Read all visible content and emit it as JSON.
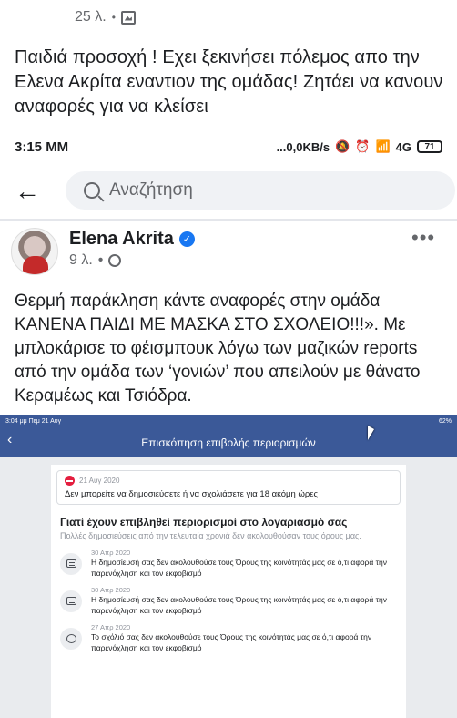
{
  "top_post": {
    "time": "25 λ.",
    "text": "Παιδιά προσοχή ! Εχει ξεκινήσει πόλεμος απο την Ελενα Ακρίτα εναντιον της ομάδας! Ζητάει να κανουν αναφορές για να κλείσει"
  },
  "status_bar": {
    "time": "3:15 ΜΜ",
    "network": "...0,0KB/s",
    "signal": "4G",
    "battery": "71"
  },
  "search": {
    "placeholder": "Αναζήτηση"
  },
  "post": {
    "author": "Elena Akrita",
    "time": "9 λ.",
    "text": "Θερμή παράκληση κάντε αναφορές στην ομάδα ΚΑΝΕΝΑ ΠΑΙΔΙ ΜΕ ΜΑΣΚΑ ΣΤΟ ΣΧΟΛΕΙΟ!!!». Με μπλοκάρισε το φέισμπουκ λόγω των μαζικών reports από την ομάδα των ‘γονιών’ που απειλούν με θάνατο Κεραμέως και Τσιόδρα."
  },
  "embedded": {
    "status_left": "3:04 μμ  Πεμ 21 Αυγ",
    "status_right": "62%",
    "nav_title": "Επισκόπηση επιβολής περιορισμών",
    "alert": {
      "date": "21 Αυγ 2020",
      "message": "Δεν μπορείτε να δημοσιεύσετε ή να σχολιάσετε για 18 ακόμη ώρες"
    },
    "heading": "Γιατί έχουν επιβληθεί περιορισμοί στο λογαριασμό σας",
    "subheading": "Πολλές δημοσιεύσεις από την τελευταία χρονιά δεν ακολουθούσαν τους όρους μας.",
    "items": [
      {
        "icon": "post-icon",
        "date": "30 Απρ 2020",
        "text": "Η δημοσίευσή σας δεν ακολουθούσε τους Όρους της κοινότητάς μας σε ό,τι αφορά την παρενόχληση και τον εκφοβισμό"
      },
      {
        "icon": "post-icon",
        "date": "30 Απρ 2020",
        "text": "Η δημοσίευσή σας δεν ακολουθούσε τους Όρους της κοινότητάς μας σε ό,τι αφορά την παρενόχληση και τον εκφοβισμό"
      },
      {
        "icon": "comment-icon",
        "date": "27 Απρ 2020",
        "text": "Το σχόλιό σας δεν ακολουθούσε τους Όρους της κοινότητάς μας σε ό,τι αφορά την παρενόχληση και τον εκφοβισμό"
      }
    ]
  }
}
